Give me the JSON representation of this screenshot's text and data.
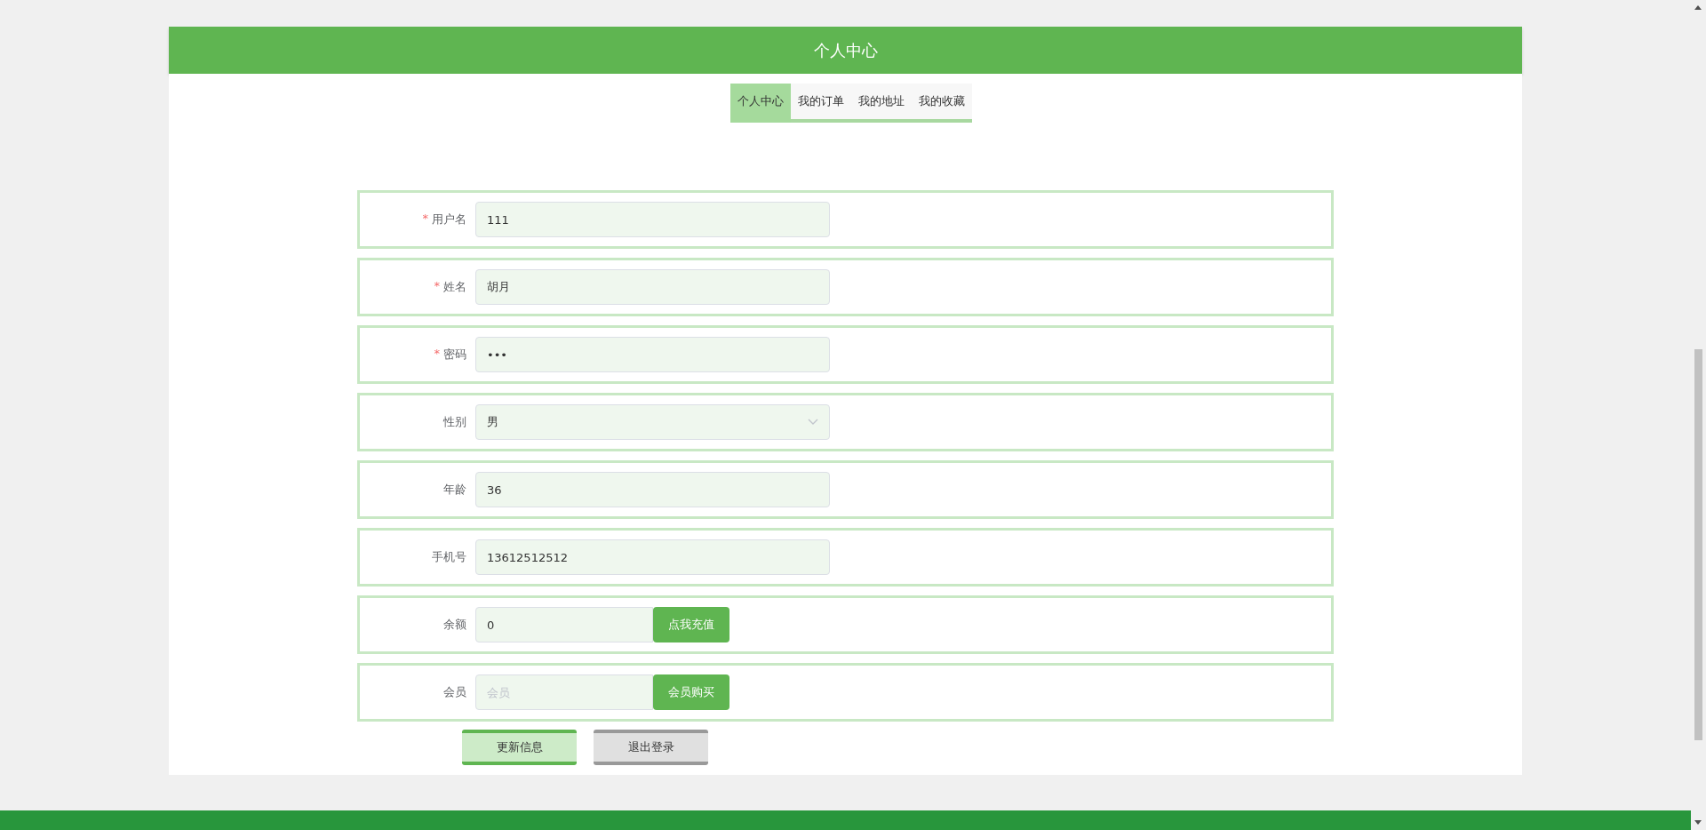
{
  "header": {
    "title": "个人中心"
  },
  "tabs": [
    {
      "label": "个人中心",
      "selected": true
    },
    {
      "label": "我的订单",
      "selected": false
    },
    {
      "label": "我的地址",
      "selected": false
    },
    {
      "label": "我的收藏",
      "selected": false
    }
  ],
  "form": {
    "fields": [
      {
        "kind": "input",
        "label": "用户名",
        "required_mark": "*",
        "value": "111"
      },
      {
        "kind": "input",
        "label": "姓名",
        "required_mark": "*",
        "value": "胡月"
      },
      {
        "kind": "input",
        "label": "密码",
        "required_mark": "*",
        "value": "•••"
      },
      {
        "kind": "select",
        "label": "性别",
        "value": "男"
      },
      {
        "kind": "input",
        "label": "年龄",
        "value": "36"
      },
      {
        "kind": "input",
        "label": "手机号",
        "value": "13612512512"
      },
      {
        "kind": "action",
        "label": "余额",
        "value": "0",
        "button": "点我充值"
      },
      {
        "kind": "action",
        "label": "会员",
        "placeholder": "会员",
        "button": "会员购买"
      }
    ]
  },
  "buttons": [
    {
      "label": "更新信息",
      "kind": "primary"
    },
    {
      "label": "退出登录",
      "kind": "secondary"
    }
  ]
}
